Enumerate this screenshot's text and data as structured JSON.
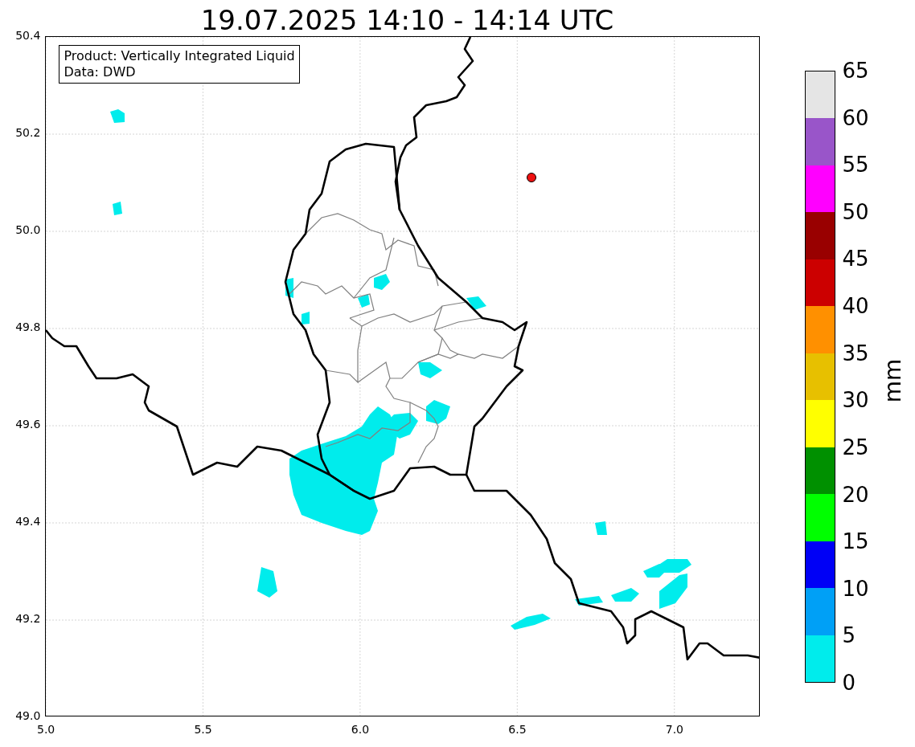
{
  "title": "19.07.2025 14:10 - 14:14 UTC",
  "legend": [
    "Product: Vertically Integrated Liquid",
    "Data: DWD"
  ],
  "axes": {
    "x_ticks": [
      "5.0",
      "5.5",
      "6.0",
      "6.5",
      "7.0"
    ],
    "y_ticks": [
      "50.4",
      "50.2",
      "50.0",
      "49.8",
      "49.6",
      "49.4",
      "49.2",
      "49.0"
    ]
  },
  "colorbar": {
    "label": "mm",
    "ticks": [
      "65",
      "60",
      "55",
      "50",
      "45",
      "40",
      "35",
      "30",
      "25",
      "20",
      "15",
      "10",
      "5",
      "0"
    ],
    "bands": [
      {
        "color": "#e5e5e5"
      },
      {
        "color": "#9955c9"
      },
      {
        "color": "#ff00ff"
      },
      {
        "color": "#990000"
      },
      {
        "color": "#cc0000"
      },
      {
        "color": "#ff9000"
      },
      {
        "color": "#e7c000"
      },
      {
        "color": "#ffff00"
      },
      {
        "color": "#009000"
      },
      {
        "color": "#00ff00"
      },
      {
        "color": "#0000f6"
      },
      {
        "color": "#00a0f6"
      },
      {
        "color": "#00ecec"
      }
    ]
  }
}
